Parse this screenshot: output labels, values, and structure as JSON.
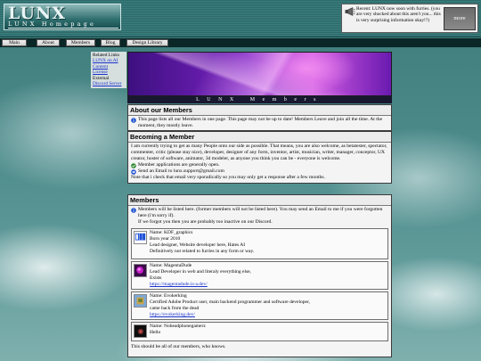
{
  "header": {
    "logo_main": "LUNX",
    "logo_sub": "LUNX Homepage",
    "notice_text": "Recent: LUNX now soon with furries. (you are very shocked about this aren't you... this is very surprising information okay!?)",
    "more_label": "more"
  },
  "nav": [
    "Main",
    "About",
    "Members",
    "Blog",
    "Design Library"
  ],
  "sidebar": {
    "heading": "Related Links",
    "items": [
      {
        "label": "LUNX on AI",
        "type": "link"
      },
      {
        "label": "Content",
        "type": "link"
      },
      {
        "label": "License",
        "type": "link"
      },
      {
        "label": "External",
        "type": "text"
      },
      {
        "label": "Discord Server",
        "type": "link"
      }
    ]
  },
  "banner": {
    "title": "LUNX Members"
  },
  "about": {
    "title": "About our Members",
    "text": "This page lists all our Members in one page. This page may not be up to date! Members Leave and join all the time. At the moment, they mostly leave."
  },
  "becoming": {
    "title": "Becoming a Member",
    "intro": "I am currently trying to get as many People onto our side as possible. That means, you are also welcome, as betatester, spectator, commenter, critic (please stay nice), developer, designer of any form, inventor, artist, musician, writer, manager, conceptor, UX creator, hoster of software, animator, 3d modeler, as anyone you think you can be - everyone is welcome.",
    "open": "Member applications are generally open.",
    "send": "Send an Email to lunx.support@gmail.com",
    "note": "Note that i check that email very sporadically so you may only get a response after a few months."
  },
  "members": {
    "title": "Members",
    "note1": "Members will be listed here. (former members will not be listed here). You may send an Email to me if you were forgotten here (i'm sorry if).",
    "note2": "If we forgot you then you are probably too inactive on our Discord.",
    "list": [
      {
        "lines": [
          "Name: KDF_graphics",
          "Born year 2010",
          "Lead designer, Website developer here, Hates AI",
          "Definitively not related to furries in any form or way."
        ],
        "link": "",
        "avatar": "kdf-avatar"
      },
      {
        "lines": [
          "Name: MagentaDude",
          "Lead Developer in web and literaly everything else,",
          "Exists"
        ],
        "link": "https://magentadude.is-a.dev/",
        "avatar": "magentadude-avatar"
      },
      {
        "lines": [
          "Name: Evokerking",
          "Certified Adobe Product user, main backend programmer and software developer,",
          "came back from the dead"
        ],
        "link": "https://evokerking.dev/",
        "avatar": "evokerking-avatar"
      },
      {
        "lines": [
          "Name: Noheadphonegamerz",
          "Hello"
        ],
        "link": "",
        "avatar": "noheadphonegamerz-avatar"
      }
    ],
    "footer": "This should be all of our members, who knows."
  },
  "colors": {
    "header_bg": "#2d6b6b",
    "nav_bg": "#0a2626",
    "link": "#1a33cc",
    "banner_purple": "#7a22c2"
  }
}
